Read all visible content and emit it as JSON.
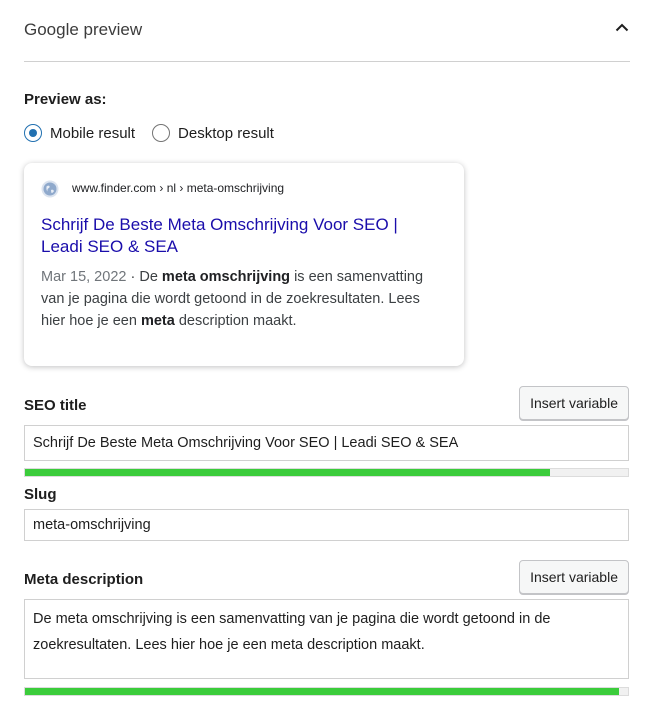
{
  "panel": {
    "title": "Google preview",
    "collapse_icon": "chevron-up-icon"
  },
  "preview_as": {
    "label": "Preview as:",
    "options": [
      {
        "label": "Mobile result",
        "checked": true
      },
      {
        "label": "Desktop result",
        "checked": false
      }
    ]
  },
  "serp": {
    "favicon_icon": "globe-icon",
    "url": "www.finder.com › nl › meta-omschrijving",
    "title": "Schrijf De Beste Meta Omschrijving Voor SEO | Leadi SEO & SEA",
    "date": "Mar 15, 2022",
    "separator": " · ",
    "desc_1": "De ",
    "desc_bold_1": "meta omschrijving",
    "desc_2": " is een samenvatting van je pagina die wordt getoond in de zoekresultaten. Lees hier hoe je een ",
    "desc_bold_2": "meta",
    "desc_3": " description maakt."
  },
  "seo_title": {
    "label": "SEO title",
    "button": "Insert variable",
    "value": "Schrijf De Beste Meta Omschrijving Voor SEO | Leadi SEO & SEA",
    "progress_percent": 87,
    "progress_color": "#3bcc3b"
  },
  "slug": {
    "label": "Slug",
    "value": "meta-omschrijving"
  },
  "meta_description": {
    "label": "Meta description",
    "button": "Insert variable",
    "value": "De meta omschrijving is een samenvatting van je pagina die wordt getoond in de zoekresultaten. Lees hier hoe je een meta description maakt.",
    "progress_percent": 98.5,
    "progress_color": "#3bcc3b"
  },
  "colors": {
    "link": "#1a0dab",
    "radio_accent": "#2271b1"
  }
}
